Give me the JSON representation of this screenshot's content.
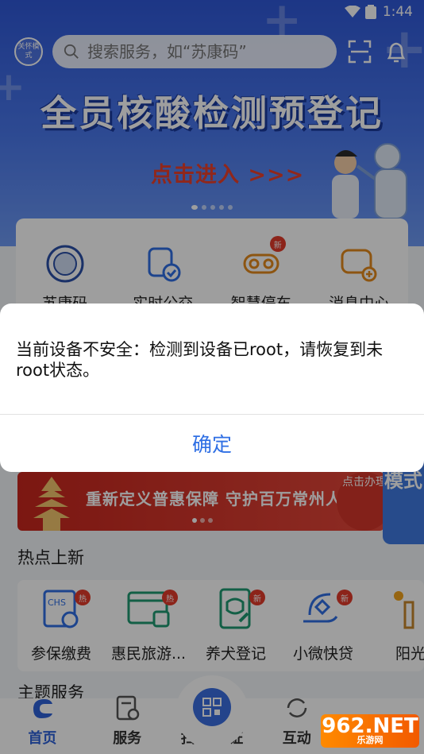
{
  "status_bar": {
    "time": "1:44"
  },
  "header": {
    "care_mode_label": "关怀模式",
    "search_placeholder": "搜索服务，如“苏康码”"
  },
  "banner": {
    "title": "全员核酸检测预登记",
    "subtitle": "点击进入 >>>"
  },
  "services": [
    {
      "label": "苏康码",
      "icon": "sukang-code-icon",
      "badge": ""
    },
    {
      "label": "实时公交",
      "icon": "bus-icon",
      "badge": ""
    },
    {
      "label": "智慧停车",
      "icon": "parking-car-icon",
      "badge": "新"
    },
    {
      "label": "消息中心",
      "icon": "message-center-icon",
      "badge": ""
    }
  ],
  "promo": {
    "text": "重新定义普惠保障 守护百万常州人",
    "button": "点击办理"
  },
  "side_tab": "模式",
  "hot_section": {
    "title": "热点上新"
  },
  "hot_items": [
    {
      "label": "参保缴费",
      "icon": "chs-insurance-icon",
      "badge": "热"
    },
    {
      "label": "惠民旅游...",
      "icon": "tourism-card-icon",
      "badge": "热"
    },
    {
      "label": "养犬登记",
      "icon": "dog-registration-icon",
      "badge": "新"
    },
    {
      "label": "小微快贷",
      "icon": "micro-loan-icon",
      "badge": "新"
    },
    {
      "label": "阳光",
      "icon": "sunshine-icon",
      "badge": ""
    }
  ],
  "theme_section": {
    "title": "主题服务"
  },
  "bottom_nav": {
    "home": "首页",
    "services": "服务",
    "scan": "扫码/亮证",
    "interact": "互动",
    "mine": ""
  },
  "watermark": {
    "text": "962.NET",
    "sub": "乐游网"
  },
  "dialog": {
    "message": "当前设备不安全：检测到设备已root，请恢复到未root状态。",
    "confirm": "确定"
  },
  "colors": {
    "brand_blue": "#2f58d8",
    "link_blue": "#2f6fe4",
    "badge_red": "#e23a2a"
  }
}
